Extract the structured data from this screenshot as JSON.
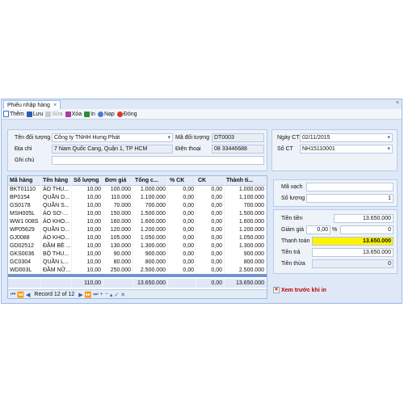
{
  "window": {
    "tab_title": "Phiếu nhập hàng",
    "tab_close": "×",
    "close": "×"
  },
  "toolbar": {
    "items": [
      {
        "label": "Thêm",
        "icon": "new-document-icon",
        "color": "#3b6fc4"
      },
      {
        "label": "Lưu",
        "icon": "save-icon",
        "color": "#2b5fb0"
      },
      {
        "label": "Sửa",
        "icon": "edit-icon",
        "color": "#9a9a9a",
        "disabled": true
      },
      {
        "label": "Xóa",
        "icon": "delete-icon",
        "color": "#b03aa0"
      },
      {
        "label": "In",
        "icon": "print-icon",
        "color": "#2f8a3a"
      },
      {
        "label": "Nạp",
        "icon": "reload-icon",
        "color": "#4a7ad0"
      },
      {
        "label": "Đóng",
        "icon": "close-icon",
        "color": "#d43a2a"
      }
    ]
  },
  "header": {
    "supplier_label": "Tên đối tượng",
    "supplier_value": "Công ty TNHH Hưng Phát",
    "code_label": "Mã đối tượng",
    "code_value": "DT0003",
    "address_label": "Địa chỉ",
    "address_value": "7 Nam Quốc Cang, Quận 1, TP HCM",
    "phone_label": "Điện thoại",
    "phone_value": "08 33446688",
    "note_label": "Ghi chú",
    "note_value": "",
    "date_label": "Ngày CT",
    "date_value": "02/11/2015",
    "doc_label": "Số CT",
    "doc_value": "NH15110001"
  },
  "grid": {
    "columns": [
      "Mã hàng",
      "Tên hàng",
      "Số lượng",
      "Đơn giá",
      "Tổng c...",
      "% CK",
      "CK",
      "Thành ti..."
    ],
    "rows": [
      [
        "BKT01110",
        "ÁO THU...",
        "10,00",
        "100.000",
        "1.000.000",
        "0,00",
        "0,00",
        "1.000.000"
      ],
      [
        "BP0154",
        "QUẦN D...",
        "10,00",
        "110.000",
        "1.100.000",
        "0,00",
        "0,00",
        "1.100.000"
      ],
      [
        "GS0178",
        "QUẦN S...",
        "10,00",
        "70.000",
        "700.000",
        "0,00",
        "0,00",
        "700.000"
      ],
      [
        "MSH005L",
        "ÁO SƠ-...",
        "10,00",
        "150.000",
        "1.500.000",
        "0,00",
        "0,00",
        "1.500.000"
      ],
      [
        "WW1 008S",
        "ÁO KHO...",
        "10,00",
        "160.000",
        "1.600.000",
        "0,00",
        "0,00",
        "1.600.000"
      ],
      [
        "WP05629",
        "QUẦN D...",
        "10,00",
        "120.000",
        "1.200.000",
        "0,00",
        "0,00",
        "1.200.000"
      ],
      [
        "GJ0088",
        "ÁO KHO...",
        "10,00",
        "105.000",
        "1.050.000",
        "0,00",
        "0,00",
        "1.050.000"
      ],
      [
        "GD02512",
        "ĐẦM BÉ ...",
        "10,00",
        "130.000",
        "1.300.000",
        "0,00",
        "0,00",
        "1.300.000"
      ],
      [
        "GKS0036",
        "BỘ THU...",
        "10,00",
        "90.000",
        "900.000",
        "0,00",
        "0,00",
        "900.000"
      ],
      [
        "GC0304",
        "QUẦN L...",
        "10,00",
        "80.000",
        "800.000",
        "0,00",
        "0,00",
        "800.000"
      ],
      [
        "WD003L",
        "ĐẦM NỮ...",
        "10,00",
        "250.000",
        "2.500.000",
        "0,00",
        "0,00",
        "2.500.000"
      ]
    ],
    "totals": [
      "",
      "",
      "110,00",
      "",
      "13.650.000",
      "",
      "0,00",
      "13.650.000"
    ],
    "record_text": "Record 12 of 12"
  },
  "side": {
    "barcode_label": "Mã vạch",
    "barcode_value": "",
    "qty_label": "Số lượng",
    "qty_value": "1",
    "total_label": "Tiền tiền",
    "total_value": "13.650.000",
    "discount_label": "Giảm giá",
    "discount_pct": "0,00",
    "pct_sign": "%",
    "discount_value": "0",
    "pay_label": "Thanh toán",
    "pay_value": "13.650.000",
    "paid_label": "Tiền trả",
    "paid_value": "13.650.000",
    "change_label": "Tiền thừa",
    "change_value": "0",
    "preview_label": "Xem trước khi in",
    "preview_checked": true
  },
  "colors": {
    "highlight": "#fff200",
    "accent": "#99bbe8",
    "preview": "#c00000"
  }
}
